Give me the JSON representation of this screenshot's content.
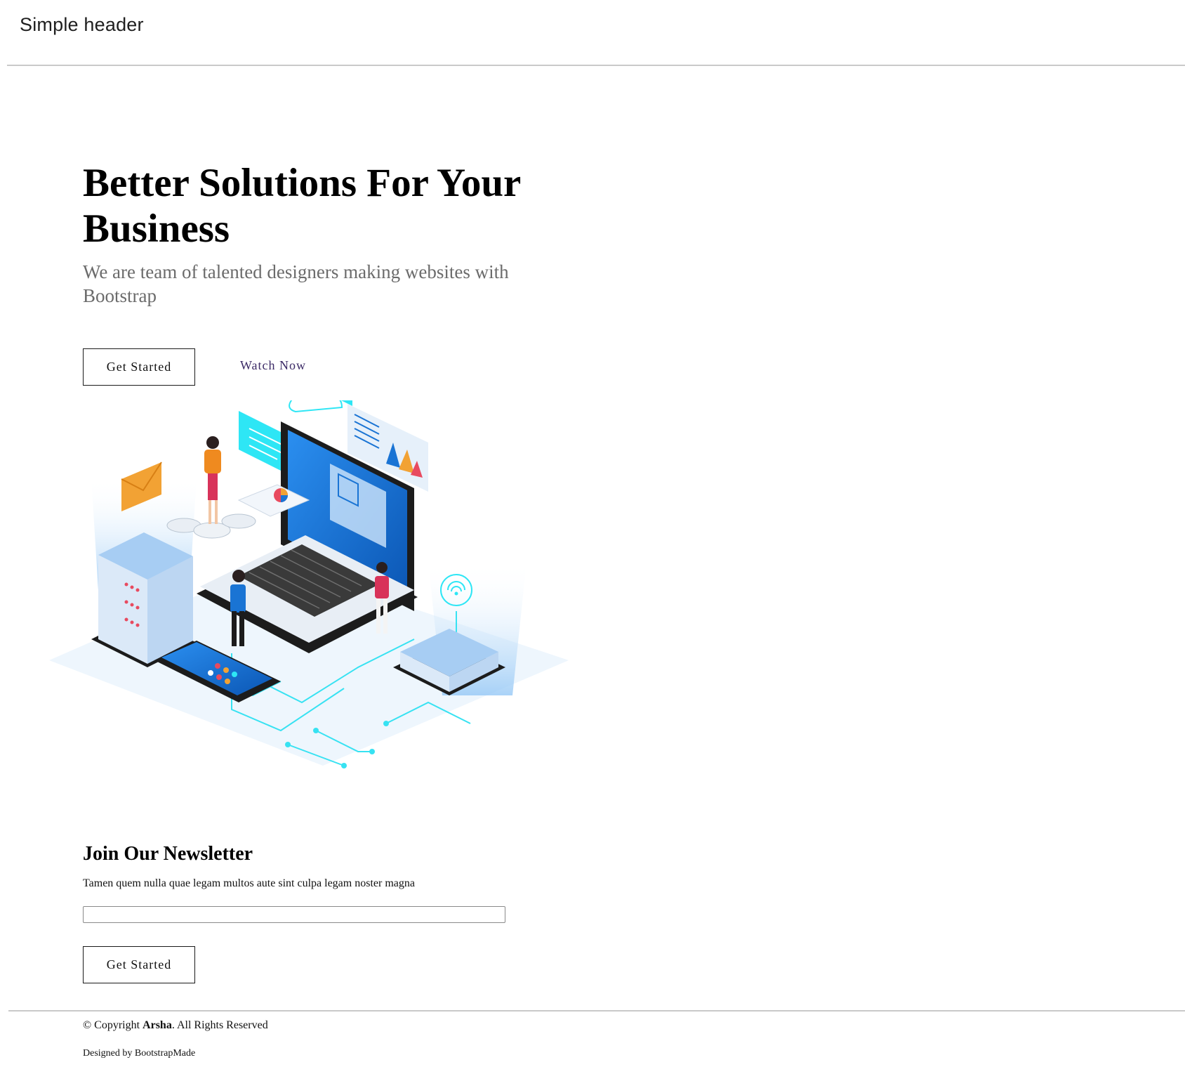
{
  "header": {
    "title": "Simple header"
  },
  "hero": {
    "title": "Better Solutions For Your Business",
    "subtitle": "We are team of talented designers making websites with Bootstrap",
    "primary_button": "Get Started",
    "secondary_link": "Watch Now",
    "illustration": {
      "description_icon": "isometric-tech-illustration-icon",
      "colors": {
        "cyan": "#2ee6f5",
        "blue": "#1a74d4",
        "light_blue": "#cfe6fb",
        "orange": "#f2a234",
        "dark": "#1c1c1c"
      }
    }
  },
  "newsletter": {
    "title": "Join Our Newsletter",
    "text": "Tamen quem nulla quae legam multos aute sint culpa legam noster magna",
    "input_value": "",
    "button": "Get Started"
  },
  "footer": {
    "copyright_prefix": "© Copyright ",
    "brand": "Arsha",
    "copyright_suffix": ". All Rights Reserved",
    "credits": "Designed by BootstrapMade"
  }
}
